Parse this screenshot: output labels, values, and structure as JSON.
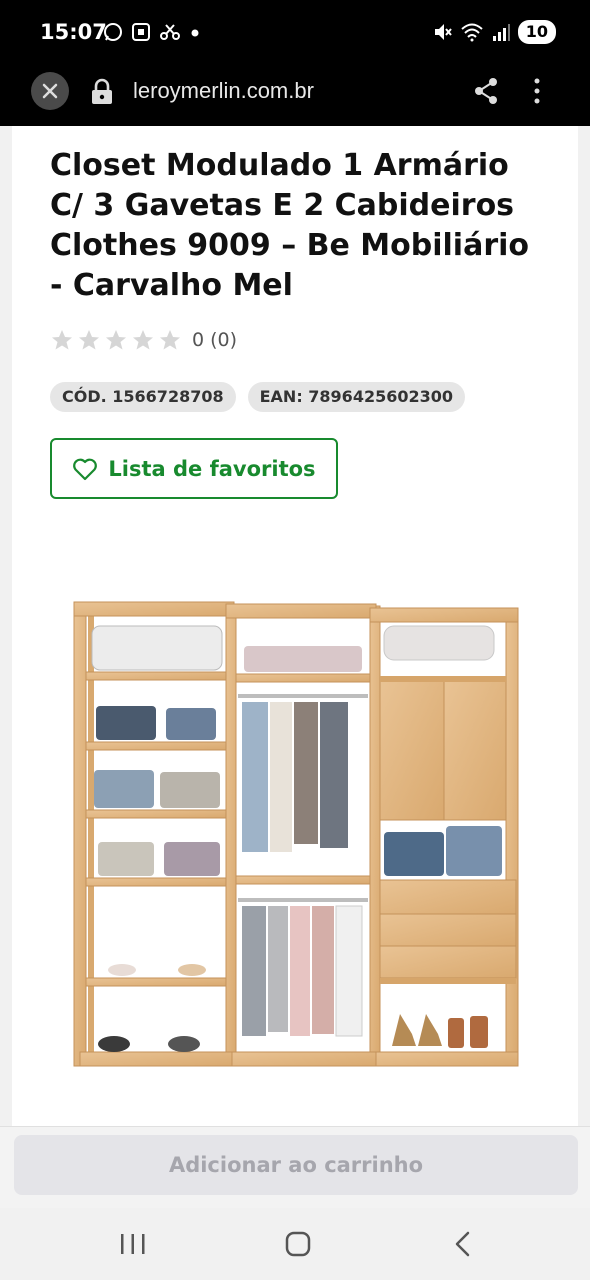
{
  "status_bar": {
    "time": "15:07",
    "battery": "10",
    "left_icons": [
      "whatsapp-icon",
      "screenshot-icon",
      "scissors-icon",
      "dot-icon"
    ],
    "right_icons": [
      "mute-icon",
      "wifi-icon",
      "signal-icon"
    ]
  },
  "browser": {
    "url": "leroymerlin.com.br"
  },
  "product": {
    "title": "Closet Modulado 1 Armário C/ 3 Gavetas E 2 Cabideiros Clothes 9009 – Be Mobiliário - Carvalho Mel",
    "rating_text": "0 (0)",
    "rating_stars": 0,
    "code": "CÓD. 1566728708",
    "ean": "EAN: 7896425602300",
    "favorites_label": "Lista de favoritos"
  },
  "cart": {
    "add_label": "Adicionar ao carrinho"
  },
  "colors": {
    "brand_green": "#188a2e",
    "wood": "#e3b985",
    "disabled_text": "#a6a6ad"
  }
}
